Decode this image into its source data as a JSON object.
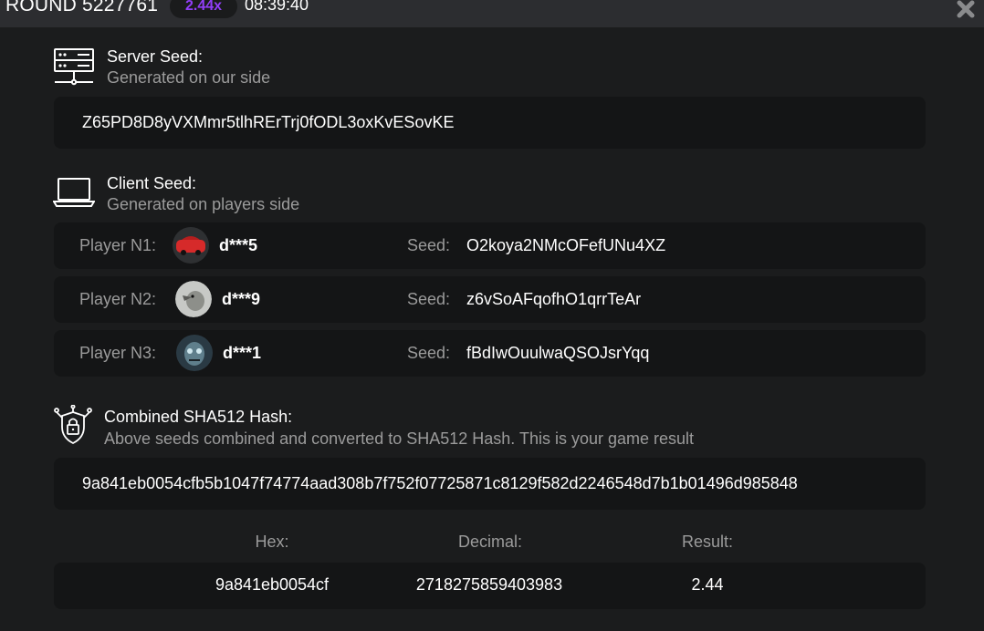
{
  "header": {
    "round_title": "ROUND 5227761",
    "multiplier": "2.44x",
    "time": "08:39:40",
    "close_icon": "close-icon"
  },
  "server_seed": {
    "icon": "server-icon",
    "title": "Server Seed:",
    "subtitle": "Generated on our side",
    "value": "Z65PD8D8yVXMmr5tlhRErTrj0fODL3oxKvESovKE"
  },
  "client_seed": {
    "icon": "laptop-icon",
    "title": "Client Seed:",
    "subtitle": "Generated on players side",
    "players": [
      {
        "label": "Player N1:",
        "name": "d***5",
        "seed_label": "Seed:",
        "seed": "O2koya2NMcOFefUNu4XZ",
        "avatar": "car-avatar"
      },
      {
        "label": "Player N2:",
        "name": "d***9",
        "seed_label": "Seed:",
        "seed": "z6vSoAFqofhO1qrrTeAr",
        "avatar": "bird-avatar"
      },
      {
        "label": "Player N3:",
        "name": "d***1",
        "seed_label": "Seed:",
        "seed": "fBdIwOuulwaQSOJsrYqq",
        "avatar": "zombie-avatar"
      }
    ]
  },
  "combined_hash": {
    "icon": "shield-lock-icon",
    "title": "Combined SHA512 Hash:",
    "subtitle": "Above seeds combined and converted to SHA512 Hash. This is your game result",
    "value": "9a841eb0054cfb5b1047f74774aad308b7f752f07725871c8129f582d2246548d7b1b01496d985848"
  },
  "result": {
    "hex_label": "Hex:",
    "decimal_label": "Decimal:",
    "result_label": "Result:",
    "hex": "9a841eb0054cf",
    "decimal": "2718275859403983",
    "result": "2.44"
  },
  "colors": {
    "background": "#1b1c1d",
    "panel": "#141516",
    "header": "#2c2d30",
    "accent": "#913ef8",
    "muted_text": "#9b9b9b"
  }
}
